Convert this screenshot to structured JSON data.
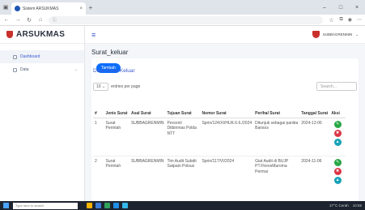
{
  "browser": {
    "tab_title": "Sistem ARSUKMAS",
    "tab_close": "×",
    "new_tab": "+",
    "url": "",
    "min": "–",
    "max": "□",
    "close": "×"
  },
  "sidebar": {
    "brand": "ARSUKMAS",
    "items": [
      {
        "label": "Dashboard",
        "chevron": ""
      },
      {
        "label": "Data",
        "chevron": "⌄"
      }
    ]
  },
  "topbar": {
    "hamburger": "≡",
    "user": "SUBBAGRENMIN"
  },
  "main": {
    "page_title": "Surat_keluar",
    "add_button": "Tambah",
    "card_title": "Data Surat Keluar",
    "length_value": "10",
    "length_suffix": "entries per page",
    "search_placeholder": "Search...",
    "columns": [
      "#",
      "Jenis Surat",
      "Asal Surat",
      "Tujuan Surat",
      "Nomor Surat",
      "Perihal Surat",
      "Tanggal Surat",
      "Aksi"
    ],
    "rows": [
      {
        "no": "1",
        "jenis": "Surat Perintah",
        "asal": "SUBBAGRENMIN",
        "tujuan": "Personil Ditbinmas Polda NTT",
        "nomor": "Sprin/124/XI/HUK.6.6./2024",
        "perihal": "Ditunjuk sebagai panitia Bansos",
        "tanggal": "2024-12-06"
      },
      {
        "no": "2",
        "jenis": "Surat Perintah",
        "asal": "SUBBAGRENMIN",
        "tujuan": "Tim Audit Subdit Satpam Polsus",
        "nomor": "Sprin/117/VI/2024",
        "perihal": "Giat Audit di BUJP PT.FloresMaroma Permai",
        "tanggal": "2024-11-06"
      }
    ]
  },
  "taskbar": {
    "search": "Type here to search",
    "weather": "27°C Cerah",
    "time": "10:55"
  }
}
